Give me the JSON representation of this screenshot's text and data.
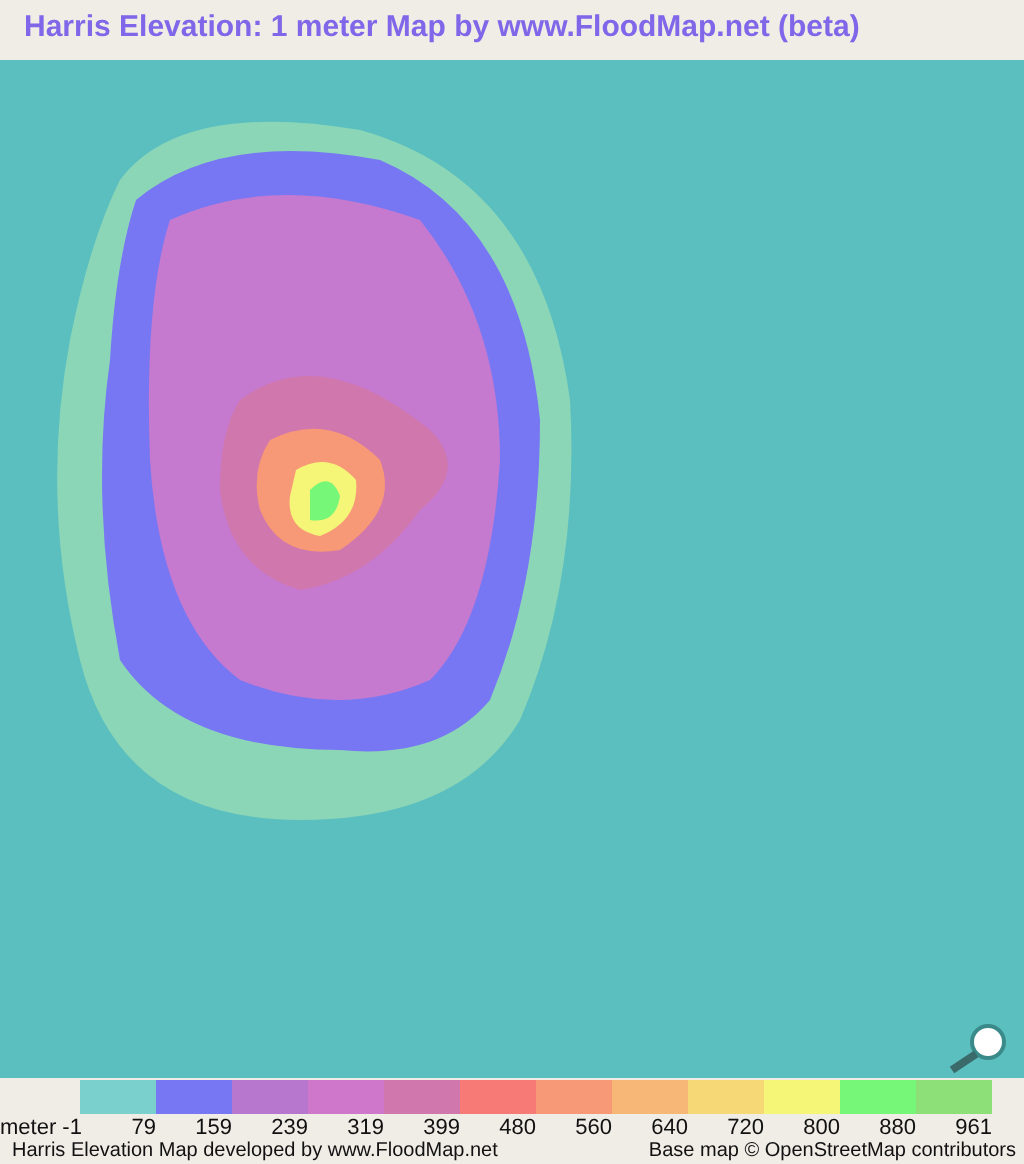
{
  "title": "Harris Elevation: 1 meter Map by www.FloodMap.net (beta)",
  "legend": {
    "first_label": "meter -1",
    "items": [
      {
        "color": "#79d0cc",
        "label": "79"
      },
      {
        "color": "#7777f3",
        "label": "159"
      },
      {
        "color": "#b777cf",
        "label": "239"
      },
      {
        "color": "#ce77cb",
        "label": "319"
      },
      {
        "color": "#d077ad",
        "label": "399"
      },
      {
        "color": "#f77a77",
        "label": "480"
      },
      {
        "color": "#f79877",
        "label": "560"
      },
      {
        "color": "#f7b877",
        "label": "640"
      },
      {
        "color": "#f7d877",
        "label": "720"
      },
      {
        "color": "#f5f577",
        "label": "800"
      },
      {
        "color": "#77f777",
        "label": "880"
      },
      {
        "color": "#8ddf77",
        "label": "961"
      }
    ]
  },
  "footer": {
    "left": "Harris Elevation Map developed by www.FloodMap.net",
    "right": "Base map © OpenStreetMap contributors"
  }
}
